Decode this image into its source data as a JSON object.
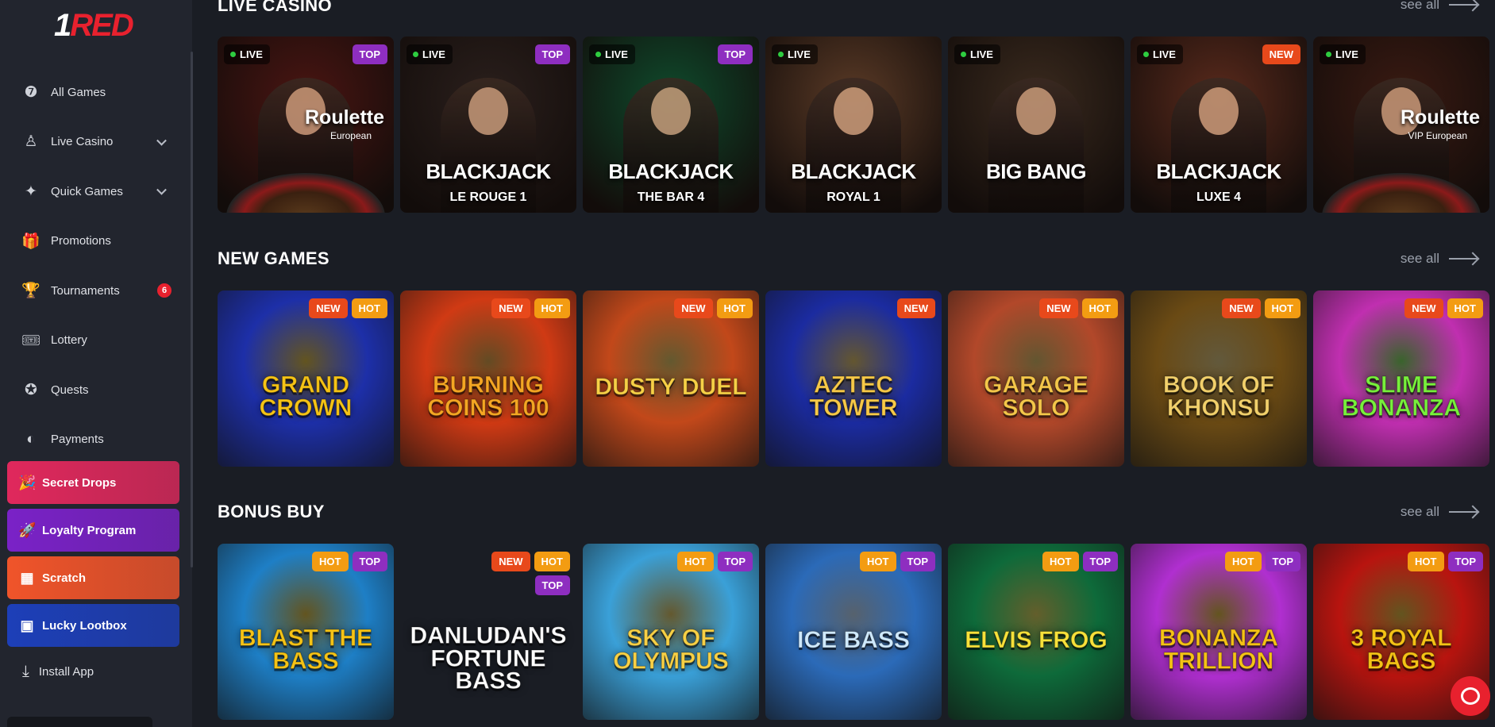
{
  "brand": {
    "logo_one": "1",
    "logo_red": "RED"
  },
  "sidebar": {
    "items": [
      {
        "label": "All Games",
        "icon": "sevens-icon"
      },
      {
        "label": "Live Casino",
        "icon": "dealer-icon",
        "expandable": true
      },
      {
        "label": "Quick Games",
        "icon": "quick-games-icon",
        "expandable": true
      },
      {
        "label": "Promotions",
        "icon": "gift-icon"
      },
      {
        "label": "Tournaments",
        "icon": "trophy-icon",
        "badge": "6"
      },
      {
        "label": "Lottery",
        "icon": "ticket-icon"
      },
      {
        "label": "Quests",
        "icon": "quest-icon"
      },
      {
        "label": "Payments",
        "icon": "wallet-icon"
      }
    ],
    "promos": [
      {
        "label": "Secret Drops",
        "icon": "confetti-icon",
        "color": "#e0285c"
      },
      {
        "label": "Loyalty Program",
        "icon": "rocket-icon",
        "color": "#7a22c7"
      },
      {
        "label": "Scratch",
        "icon": "scratch-icon",
        "color": "#f0542a"
      },
      {
        "label": "Lucky Lootbox",
        "icon": "lootbox-icon",
        "color": "#1d3fb8"
      }
    ],
    "install_label": "Install App"
  },
  "sections": {
    "live": {
      "title": "LIVE CASINO",
      "see_all": "see all"
    },
    "new": {
      "title": "NEW GAMES",
      "see_all": "see all"
    },
    "bonus": {
      "title": "BONUS BUY",
      "see_all": "see all"
    }
  },
  "live_games": [
    {
      "live": "LIVE",
      "badge": "TOP",
      "title": "Roulette",
      "subtitle": "European",
      "bg": "#4a1512",
      "kind": "roulette"
    },
    {
      "live": "LIVE",
      "badge": "TOP",
      "title": "BLACKJACK",
      "subtitle": "LE ROUGE 1",
      "bg": "#2a1f1c"
    },
    {
      "live": "LIVE",
      "badge": "TOP",
      "title": "BLACKJACK",
      "subtitle": "THE BAR 4",
      "bg": "#0f4a2c"
    },
    {
      "live": "LIVE",
      "badge": "",
      "title": "BLACKJACK",
      "subtitle": "ROYAL 1",
      "bg": "#5a3a26"
    },
    {
      "live": "LIVE",
      "badge": "",
      "title": "BIG BANG",
      "subtitle": "",
      "bg": "#3a2a1e"
    },
    {
      "live": "LIVE",
      "badge": "NEW",
      "title": "BLACKJACK",
      "subtitle": "LUXE 4",
      "bg": "#5a2a1c"
    },
    {
      "live": "LIVE",
      "badge": "",
      "title": "Roulette",
      "subtitle": "VIP European",
      "bg": "#3a1a12",
      "kind": "roulette"
    }
  ],
  "new_games": [
    {
      "title": "GRAND CROWN",
      "badges": [
        "NEW",
        "HOT"
      ],
      "bg": "#1d2fa8",
      "accent": "#f5c316"
    },
    {
      "title": "BURNING COINS 100",
      "badges": [
        "NEW",
        "HOT"
      ],
      "bg": "#d03a14",
      "accent": "#f5a623"
    },
    {
      "title": "DUSTY DUEL",
      "badges": [
        "NEW",
        "HOT"
      ],
      "bg": "#c2481a",
      "accent": "#f7d046"
    },
    {
      "title": "AZTEC TOWER",
      "badges": [
        "NEW"
      ],
      "bg": "#1b2ba0",
      "accent": "#f7c948"
    },
    {
      "title": "GARAGE SOLO",
      "badges": [
        "NEW",
        "HOT"
      ],
      "bg": "#b2482a",
      "accent": "#f5c74a"
    },
    {
      "title": "BOOK OF KHONSU",
      "badges": [
        "NEW",
        "HOT"
      ],
      "bg": "#6a4a14",
      "accent": "#f2d06b"
    },
    {
      "title": "SLIME BONANZA",
      "badges": [
        "NEW",
        "HOT"
      ],
      "bg": "#c02fb0",
      "accent": "#78f03c"
    }
  ],
  "bonus_games": [
    {
      "title": "BLAST THE BASS",
      "badges": [
        "HOT",
        "TOP"
      ],
      "bg": "#1e7fc6",
      "accent": "#f5c316"
    },
    {
      "title": "DANLUDAN'S FORTUNE BASS",
      "badges": [
        "NEW",
        "HOT",
        "TOP"
      ],
      "bg": "#2a7cc4",
      "accent": "#fff"
    },
    {
      "title": "SKY OF OLYMPUS",
      "badges": [
        "HOT",
        "TOP"
      ],
      "bg": "#3aa0d8",
      "accent": "#f7d046"
    },
    {
      "title": "ICE BASS",
      "badges": [
        "HOT",
        "TOP"
      ],
      "bg": "#2b6ab8",
      "accent": "#cfeaff"
    },
    {
      "title": "ELVIS FROG",
      "badges": [
        "HOT",
        "TOP"
      ],
      "bg": "#0e6a3a",
      "accent": "#f7e13a"
    },
    {
      "title": "BONANZA TRILLION",
      "badges": [
        "HOT",
        "TOP"
      ],
      "bg": "#b02fd0",
      "accent": "#f5c316"
    },
    {
      "title": "3 ROYAL BAGS",
      "badges": [
        "HOT",
        "TOP"
      ],
      "bg": "#b8140f",
      "accent": "#f5c316"
    }
  ]
}
